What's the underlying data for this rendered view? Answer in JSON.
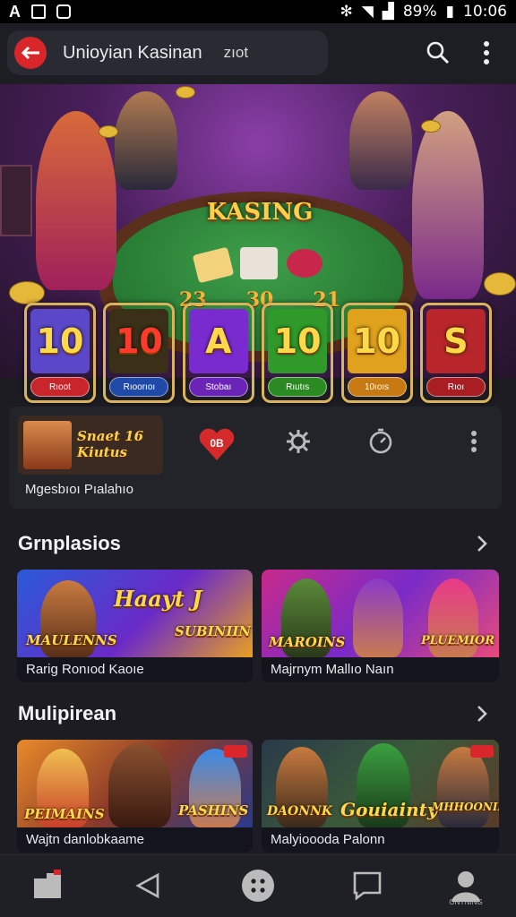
{
  "status_bar": {
    "battery_text": "89%",
    "time": "10:06"
  },
  "app_bar": {
    "title": "Unioyian Kasinan",
    "subtitle": "zıot"
  },
  "hero": {
    "title": "KASING",
    "numbers": [
      "23",
      "30",
      "21"
    ]
  },
  "tiles": [
    {
      "face": "10",
      "button": "Rıoot",
      "face_color": "#5b48c8",
      "btn_color": "#c8262b"
    },
    {
      "face": "10",
      "button": "Rıoorıoı",
      "face_color": "#3a3018",
      "btn_color": "#1f4aa8"
    },
    {
      "face": "A",
      "button": "Stobaı",
      "face_color": "#7a2bd0",
      "btn_color": "#6b24b8"
    },
    {
      "face": "10",
      "button": "Rıutıs",
      "face_color": "#2f9a2a",
      "btn_color": "#2b8a22"
    },
    {
      "face": "10",
      "button": "10ıoıs",
      "face_color": "#e0a21c",
      "btn_color": "#c87a12"
    },
    {
      "face": "S",
      "button": "Rıoı",
      "face_color": "#b8262b",
      "btn_color": "#a81e22"
    }
  ],
  "profile": {
    "avatar_caption": "Snaet 16 Kiutus",
    "name": "Mgesbıoı Pıalahıo",
    "badge": "0B"
  },
  "sections": [
    {
      "title": "Grnplasios",
      "games": [
        {
          "logo": "Haayt J",
          "logo2": "MAULENNS",
          "logo3": "SUBINIIN",
          "caption": "Rarig Ronıod Kaoıe"
        },
        {
          "logo": "MAROINS",
          "logo2": "PLUEMIOR",
          "logo3": "",
          "caption": "Majrnym Mallıo Naın"
        }
      ]
    },
    {
      "title": "Mulipirean",
      "games": [
        {
          "logo": "PEIMAINS",
          "logo2": "PASHINS",
          "logo3": "",
          "caption": "Wajtn danlobkaame"
        },
        {
          "logo": "DAONNK",
          "logo2": "Gouiainty",
          "logo3": "MHHOONING",
          "caption": "Malyioooda Palonn"
        }
      ]
    }
  ],
  "bottom_nav": {
    "profile_label": "ONYNING"
  }
}
